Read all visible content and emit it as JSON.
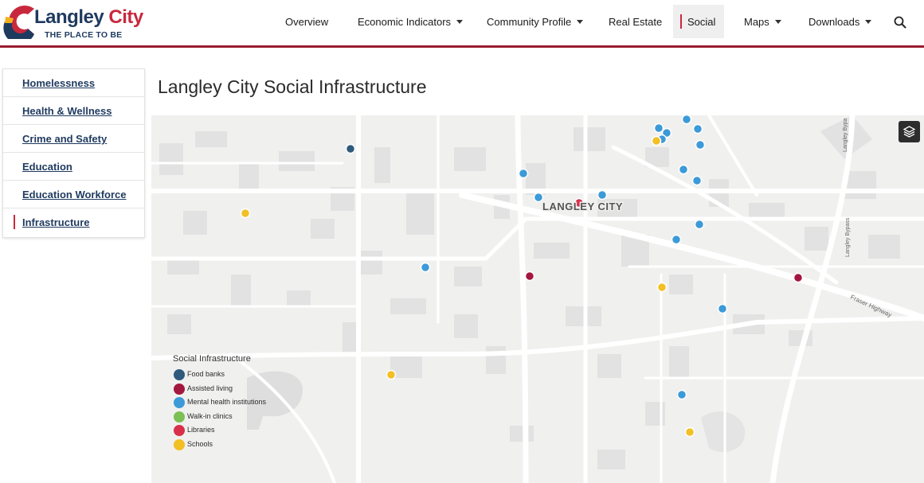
{
  "brand": {
    "name_part1": "Langley",
    "name_part2": "City",
    "tagline": "THE PLACE TO BE",
    "colors": {
      "navy": "#1f3a5f",
      "red": "#c8283d",
      "gold": "#f2b21b"
    }
  },
  "nav": {
    "items": [
      {
        "label": "Overview",
        "dropdown": false,
        "active": false
      },
      {
        "label": "Economic Indicators",
        "dropdown": true,
        "active": false
      },
      {
        "label": "Community Profile",
        "dropdown": true,
        "active": false
      },
      {
        "label": "Real Estate",
        "dropdown": false,
        "active": false
      },
      {
        "label": "Social",
        "dropdown": false,
        "active": true
      },
      {
        "label": "Maps",
        "dropdown": true,
        "active": false
      },
      {
        "label": "Downloads",
        "dropdown": true,
        "active": false
      }
    ],
    "search_icon": "search-icon"
  },
  "sidebar": {
    "items": [
      {
        "label": "Homelessness",
        "active": false
      },
      {
        "label": "Health & Wellness",
        "active": false
      },
      {
        "label": "Crime and Safety",
        "active": false
      },
      {
        "label": "Education",
        "active": false
      },
      {
        "label": "Education Workforce",
        "active": false
      },
      {
        "label": "Infrastructure",
        "active": true
      }
    ]
  },
  "main": {
    "title": "Langley City Social Infrastructure"
  },
  "map": {
    "city_label": "LANGLEY CITY",
    "road_labels": {
      "fraser_highway": "Fraser Highway",
      "bypass_top": "Langley Bypa",
      "bypass_mid": "Langley Bypass"
    },
    "layers_icon": "layers-icon",
    "legend": {
      "title": "Social Infrastructure",
      "items": [
        {
          "label": "Food banks",
          "color": "#2e5a7d"
        },
        {
          "label": "Assisted living",
          "color": "#a3173f"
        },
        {
          "label": "Mental health institutions",
          "color": "#3c9ad8"
        },
        {
          "label": "Walk-in clinics",
          "color": "#7cbf55"
        },
        {
          "label": "Libraries",
          "color": "#d8304a"
        },
        {
          "label": "Schools",
          "color": "#f2bf24"
        }
      ]
    }
  }
}
